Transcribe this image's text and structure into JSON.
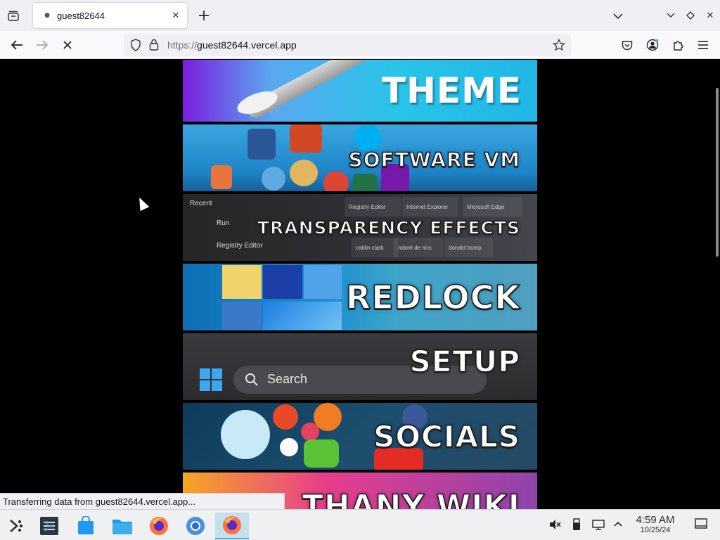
{
  "browser": {
    "tab_title": "guest82644",
    "url_protocol": "https://",
    "url_host": "guest82644.vercel.app",
    "status_text": "Transferring data from guest82644.vercel.app..."
  },
  "banners": [
    {
      "title": "THEME"
    },
    {
      "title": "SOFTWARE VM"
    },
    {
      "title": "TRANSPARENCY EFFECTS",
      "recent_label": "Recent",
      "run_label": "Run",
      "registry_label": "Registry Editor",
      "chips": [
        "Registry Editor",
        "Internet Explorer",
        "Microsoft Edge",
        "caitlin clark",
        "robert de niro",
        "donald trump"
      ]
    },
    {
      "title": "REDLOCK"
    },
    {
      "title": "SETUP",
      "search_label": "Search"
    },
    {
      "title": "SOCIALS"
    },
    {
      "title": "THANY WIKI"
    }
  ],
  "taskbar": {
    "time": "4:59 AM",
    "date": "10/25/24"
  },
  "colors": {
    "accent": "#3daee9",
    "chrome_bg": "#f0f0f4",
    "page_bg": "#000000"
  }
}
